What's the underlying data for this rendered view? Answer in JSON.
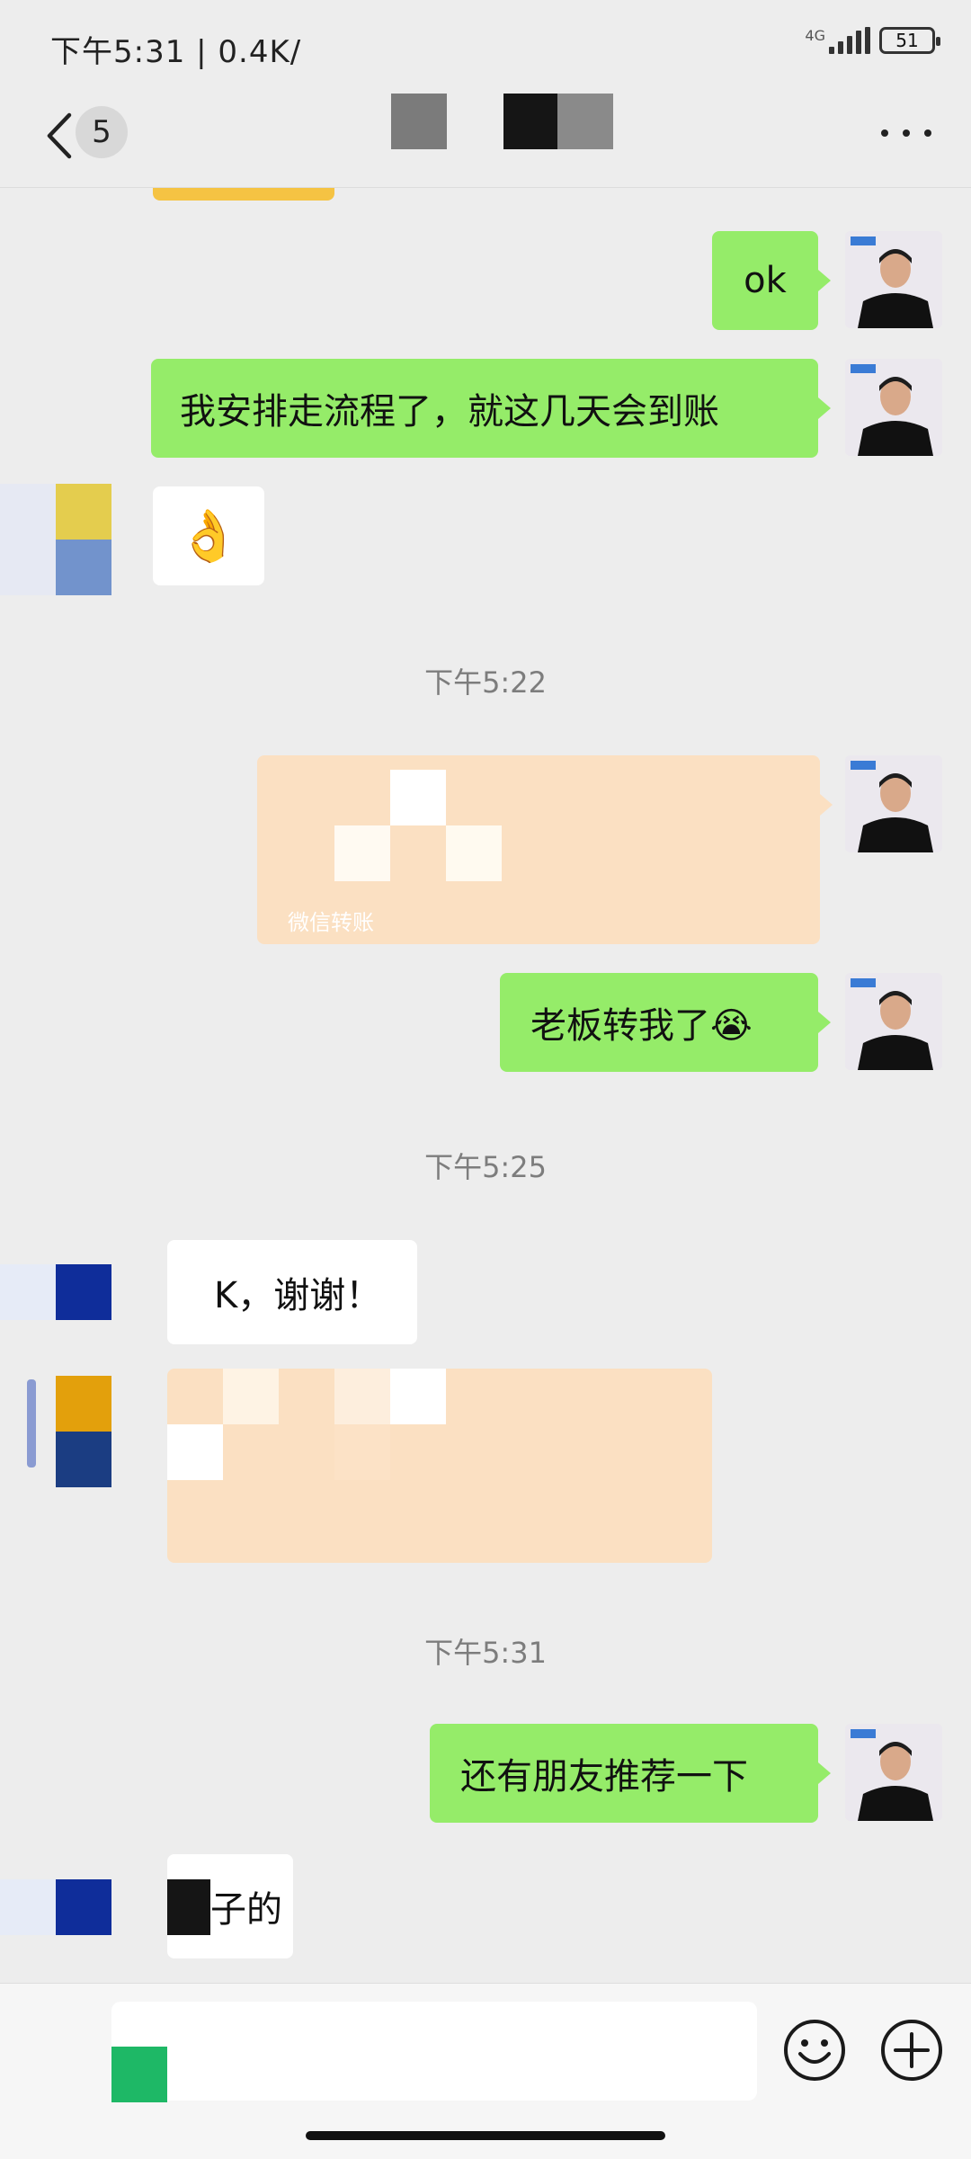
{
  "status_bar": {
    "time_text": "下午5:31 | 0.4K/",
    "network": "4G",
    "battery": "51"
  },
  "nav": {
    "unread_count": "5",
    "back_icon": "chevron-left-icon",
    "more_icon": "more-dots-icon"
  },
  "messages": {
    "m1_text": "ok",
    "m2_text": "我安排走流程了，就这几天会到账",
    "m3_emoji": "👌",
    "time1": "下午5:22",
    "m4_caption": "微信转账",
    "m5_text": "老板转我了😭",
    "time2": "下午5:25",
    "m6_text": "K，谢谢！",
    "time3": "下午5:31",
    "m8_text": "还有朋友推荐一下",
    "m9_text": "子的"
  },
  "input_bar": {
    "emoji_icon": "smiley-icon",
    "plus_icon": "plus-circle-icon"
  },
  "colors": {
    "background": "#ededed",
    "outgoing_bubble": "#95ec69",
    "incoming_bubble": "#ffffff",
    "transfer_card": "#fbe0c2"
  }
}
